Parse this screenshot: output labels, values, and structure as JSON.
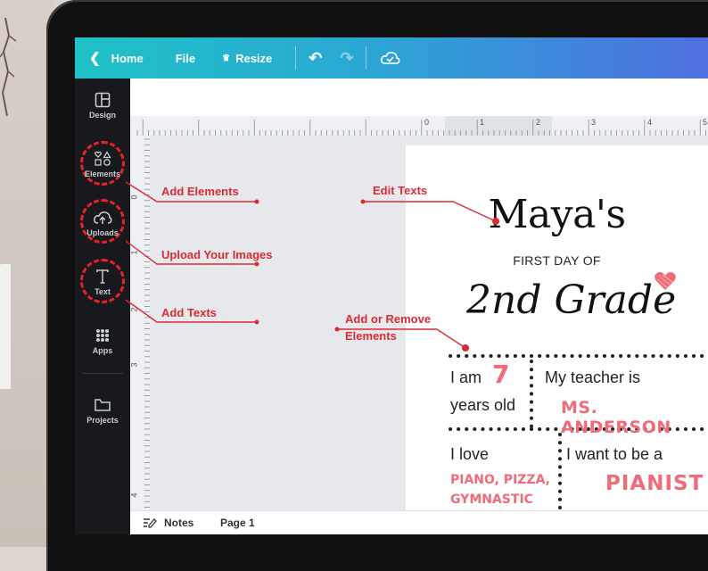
{
  "topbar": {
    "home_label": "Home",
    "file_label": "File",
    "resize_label": "Resize",
    "undo_icon": "undo-icon",
    "redo_icon": "redo-icon",
    "cloud_icon": "cloud-saved-icon"
  },
  "sidebar": {
    "items": [
      {
        "label": "Design",
        "icon": "layout-icon"
      },
      {
        "label": "Elements",
        "icon": "shapes-icon"
      },
      {
        "label": "Uploads",
        "icon": "cloud-upload-icon"
      },
      {
        "label": "Text",
        "icon": "text-icon"
      },
      {
        "label": "Apps",
        "icon": "grid-icon"
      },
      {
        "label": "Projects",
        "icon": "folder-icon"
      }
    ]
  },
  "ruler": {
    "top_ticks": [
      "0",
      "1",
      "2",
      "3",
      "4",
      "5"
    ],
    "left_ticks": [
      "0",
      "1",
      "2",
      "3",
      "4"
    ]
  },
  "annotations": {
    "add_elements": "Add Elements",
    "upload_images": "Upload Your Images",
    "add_texts": "Add Texts",
    "edit_texts": "Edit Texts",
    "add_remove_line1": "Add or Remove",
    "add_remove_line2": "Elements",
    "color": "#d92b33"
  },
  "poster": {
    "name": "Maya's",
    "subtitle": "FIRST DAY OF",
    "grade": "2nd Grade",
    "i_am": "I am",
    "age": "7",
    "years_old": "years old",
    "teacher_label": "My teacher is",
    "teacher_name": "MS. ANDERSON",
    "i_love": "I love",
    "love_line1": "PIANO, PIZZA,",
    "love_line2": "GYMNASTIC",
    "want_label": "I want to be a",
    "want_value": "PIANIST",
    "accent_color": "#ef6b78"
  },
  "bottombar": {
    "notes_label": "Notes",
    "page_label": "Page 1"
  }
}
